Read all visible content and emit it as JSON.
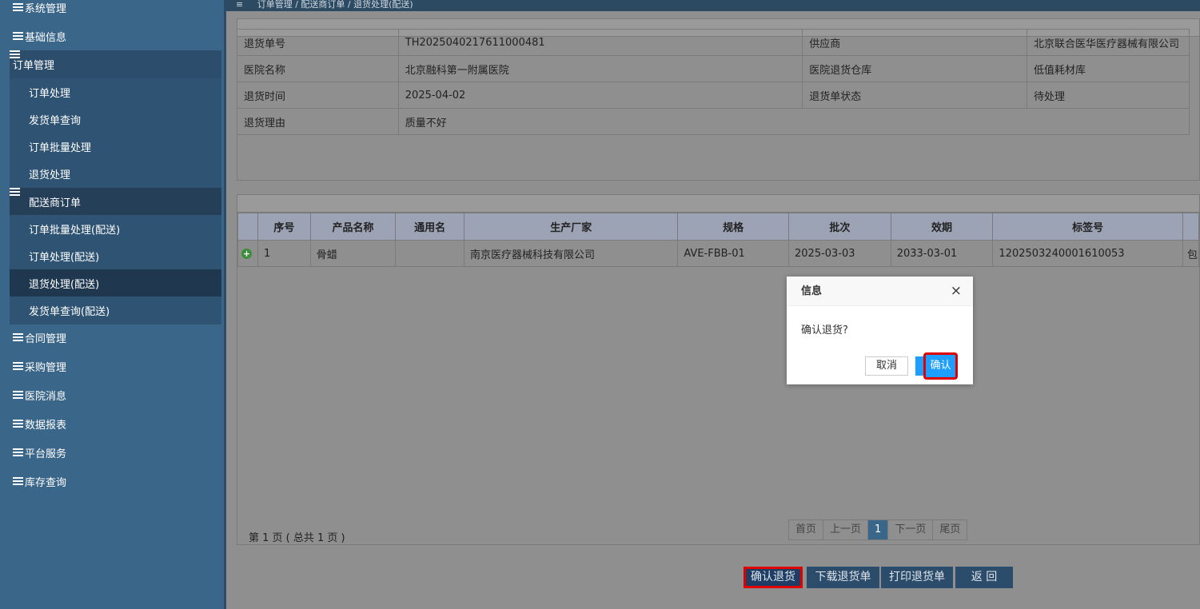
{
  "sidebar": {
    "top_items": [
      {
        "label": "系统管理"
      },
      {
        "label": "基础信息"
      }
    ],
    "order_group": {
      "label": "订单管理",
      "items": [
        {
          "label": "订单处理"
        },
        {
          "label": "发货单查询"
        },
        {
          "label": "订单批量处理"
        },
        {
          "label": "退货处理"
        },
        {
          "label": "配送商订单"
        },
        {
          "label": "订单批量处理(配送)"
        },
        {
          "label": "订单处理(配送)"
        },
        {
          "label": "退货处理(配送)"
        },
        {
          "label": "发货单查询(配送)"
        }
      ]
    },
    "bottom_items": [
      {
        "label": "合同管理"
      },
      {
        "label": "采购管理"
      },
      {
        "label": "医院消息"
      },
      {
        "label": "数据报表"
      },
      {
        "label": "平台服务"
      },
      {
        "label": "库存查询"
      }
    ]
  },
  "breadcrumb": {
    "menu_icon": "≡",
    "text": "订单管理  /  配送商订单  /  退货处理(配送)"
  },
  "return_info": {
    "rows": [
      {
        "l1": "退货单号",
        "v1": "TH2025040217611000481",
        "l2": "供应商",
        "v2": "北京联合医华医疗器械有限公司"
      },
      {
        "l1": "医院名称",
        "v1": "北京融科第一附属医院",
        "l2": "医院退货仓库",
        "v2": "低值耗材库"
      },
      {
        "l1": "退货时间",
        "v1": "2025-04-02",
        "l2": "退货单状态",
        "v2": "待处理"
      },
      {
        "l1": "退货理由",
        "v1": "质量不好",
        "l2": "",
        "v2": ""
      }
    ]
  },
  "items_table": {
    "headers": [
      "序号",
      "产品名称",
      "通用名",
      "生产厂家",
      "规格",
      "批次",
      "效期",
      "标签号"
    ],
    "rows": [
      {
        "no": "1",
        "name": "骨蜡",
        "generic": "",
        "maker": "南京医疗器械科技有限公司",
        "spec": "AVE-FBB-01",
        "batch": "2025-03-03",
        "expiry": "2033-03-01",
        "tag": "1202503240001610053",
        "extra": "包"
      }
    ]
  },
  "pagination": {
    "info": "第 1 页 ( 总共 1 页 )",
    "first": "首页",
    "prev": "上一页",
    "current": "1",
    "next": "下一页",
    "last": "尾页"
  },
  "actions": {
    "confirm": "确认退货",
    "download": "下载退货单",
    "print": "打印退货单",
    "back": "返 回"
  },
  "dialog": {
    "title": "信息",
    "message": "确认退货?",
    "cancel": "取消",
    "ok": "确认",
    "close_icon": "×"
  }
}
